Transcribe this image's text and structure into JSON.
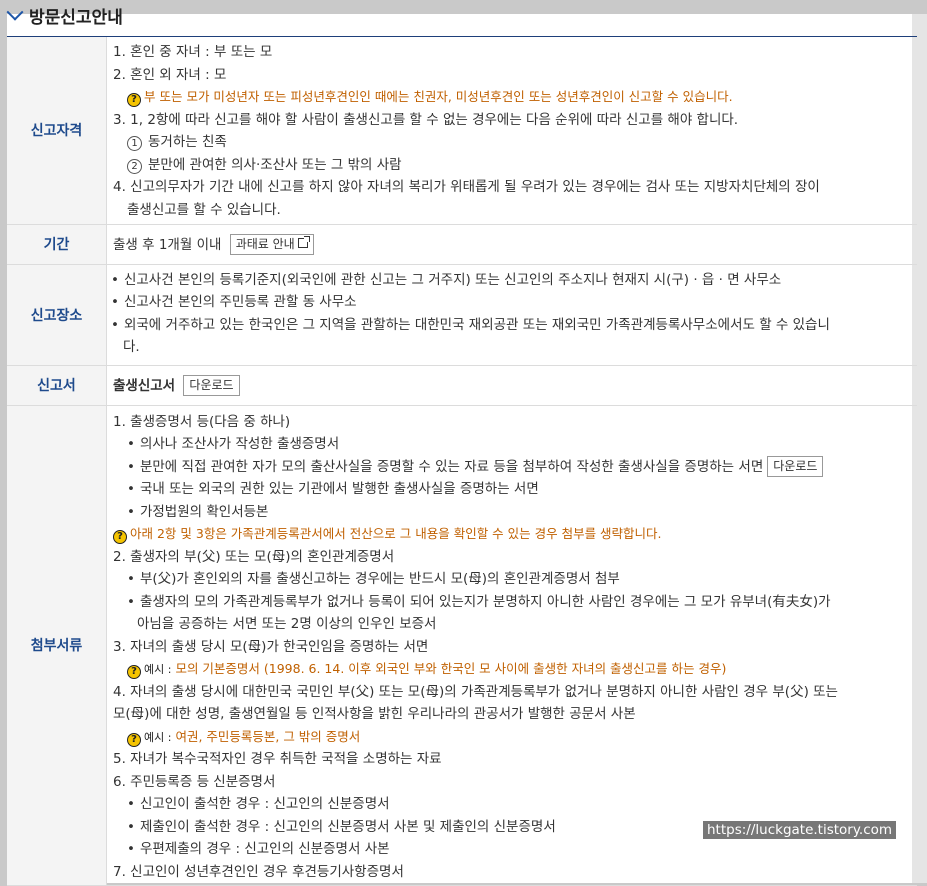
{
  "header": {
    "title": "방문신고안내"
  },
  "rows": {
    "qualification": {
      "label": "신고자격",
      "l1": "1. 혼인 중 자녀 : 부 또는 모",
      "l2": "2. 혼인 외 자녀 : 모",
      "note": "부 또는 모가 미성년자 또는 피성년후견인인 때에는 친권자, 미성년후견인 또는 성년후견인이 신고할 수 있습니다.",
      "l3": "3. 1, 2항에 따라 신고를 해야 할 사람이 출생신고를 할 수 없는 경우에는 다음 순위에 따라 신고를 해야 합니다.",
      "sub1_mark": "1",
      "sub1": "동거하는 친족",
      "sub2_mark": "2",
      "sub2": "분만에 관여한 의사·조산사 또는 그 밖의 사람",
      "l4a": "4. 신고의무자가 기간 내에 신고를 하지 않아 자녀의 복리가 위태롭게 될 우려가 있는 경우에는 검사 또는 지방자치단체의 장이",
      "l4b": "출생신고를 할 수 있습니다."
    },
    "period": {
      "label": "기간",
      "text": "출생 후 1개월 이내",
      "button": "과태료 안내"
    },
    "place": {
      "label": "신고장소",
      "b1": "신고사건 본인의 등록기준지(외국인에 관한 신고는 그 거주지) 또는 신고인의 주소지나 현재지 시(구) · 읍 · 면 사무소",
      "b2": "신고사건 본인의 주민등록 관할 동 사무소",
      "b3a": "외국에 거주하고 있는 한국인은 그 지역을 관할하는 대한민국 재외공관 또는 재외국민 가족관계등록사무소에서도 할 수 있습니",
      "b3b": "다."
    },
    "form": {
      "label": "신고서",
      "text": "출생신고서",
      "button": "다운로드"
    },
    "docs": {
      "label": "첨부서류",
      "l1": "1. 출생증명서 등(다음 중 하나)",
      "l1a": "의사나 조산사가 작성한 출생증명서",
      "l1b": "분만에 직접 관여한 자가 모의 출산사실을 증명할 수 있는 자료 등을 첨부하여 작성한 출생사실을 증명하는 서면",
      "l1b_button": "다운로드",
      "l1c": "국내 또는 외국의 권한 있는 기관에서 발행한 출생사실을 증명하는 서면",
      "l1d": "가정법원의 확인서등본",
      "note1": "아래 2항 및 3항은 가족관계등록관서에서 전산으로 그 내용을 확인할 수 있는 경우 첨부를 생략합니다.",
      "l2": "2. 출생자의 부(父) 또는 모(母)의 혼인관계증명서",
      "l2a": "부(父)가 혼인외의 자를 출생신고하는 경우에는 반드시 모(母)의 혼인관계증명서 첨부",
      "l2b1": "출생자의 모의 가족관계등록부가 없거나 등록이 되어 있는지가 분명하지 아니한 사람인 경우에는 그 모가 유부녀(有夫女)가",
      "l2b2": "아님을 공증하는 서면 또는 2명 이상의 인우인 보증서",
      "l3": "3. 자녀의 출생 당시 모(母)가 한국인임을 증명하는 서면",
      "ex_label": "예시 :",
      "ex1": "모의 기본증명서 (1998. 6. 14. 이후 외국인 부와 한국인 모 사이에 출생한 자녀의 출생신고를 하는 경우)",
      "l4a": "4. 자녀의 출생 당시에 대한민국 국민인 부(父) 또는 모(母)의 가족관계등록부가 없거나 분명하지 아니한 사람인 경우 부(父) 또는",
      "l4b": "모(母)에 대한 성명, 출생연월일 등 인적사항을 밝힌 우리나라의 관공서가 발행한 공문서 사본",
      "ex2": "여권, 주민등록등본, 그 밖의 증명서",
      "l5": "5. 자녀가 복수국적자인 경우 취득한 국적을 소명하는 자료",
      "l6": "6. 주민등록증 등 신분증명서",
      "l6a": "신고인이 출석한 경우 : 신고인의 신분증명서",
      "l6b": "제출인이 출석한 경우 : 신고인의 신분증명서 사본 및 제출인의 신분증명서",
      "l6c": "우편제출의 경우 : 신고인의 신분증명서 사본",
      "l7": "7. 신고인이 성년후견인인 경우 후견등기사항증명서"
    }
  },
  "watermark": "https://luckgate.tistory.com",
  "colors": {
    "accent": "#1e4a8c",
    "note": "#c06000"
  }
}
